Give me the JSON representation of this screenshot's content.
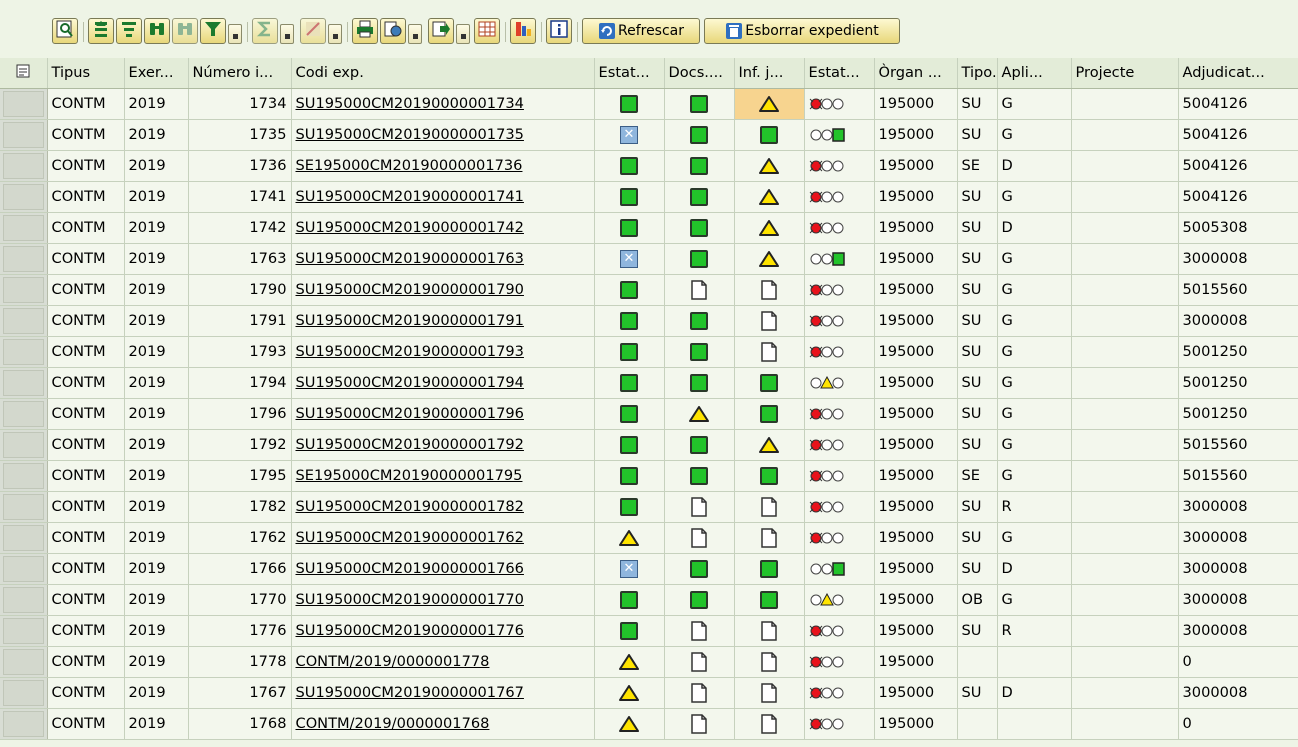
{
  "toolbar": {
    "refresh_label": "Refrescar",
    "delete_label": "Esborrar expedient"
  },
  "columns": [
    "Tipus",
    "Exer...",
    "Número i...",
    "Codi exp.",
    "Estat...",
    "Docs....",
    "Inf. j...",
    "Estat...",
    "Òrgan ...",
    "Tipo...",
    "Apli...",
    "Projecte",
    "Adjudicat..."
  ],
  "rows": [
    {
      "tipus": "CONTM",
      "exer": "2019",
      "num": "1734",
      "codi": "SU195000CM20190000001734",
      "estat": "green",
      "docs": "green",
      "inf": "warn",
      "light": "red",
      "organ": "195000",
      "tipo": "SU",
      "apli": "G",
      "projecte": "",
      "adj": "5004126",
      "inf_hl": true
    },
    {
      "tipus": "CONTM",
      "exer": "2019",
      "num": "1735",
      "codi": "SU195000CM20190000001735",
      "estat": "x",
      "docs": "green",
      "inf": "green",
      "light": "green",
      "organ": "195000",
      "tipo": "SU",
      "apli": "G",
      "projecte": "",
      "adj": "5004126"
    },
    {
      "tipus": "CONTM",
      "exer": "2019",
      "num": "1736",
      "codi": "SE195000CM20190000001736",
      "estat": "green",
      "docs": "green",
      "inf": "warn",
      "light": "red",
      "organ": "195000",
      "tipo": "SE",
      "apli": "D",
      "projecte": "",
      "adj": "5004126"
    },
    {
      "tipus": "CONTM",
      "exer": "2019",
      "num": "1741",
      "codi": "SU195000CM20190000001741",
      "estat": "green",
      "docs": "green",
      "inf": "warn",
      "light": "red",
      "organ": "195000",
      "tipo": "SU",
      "apli": "G",
      "projecte": "",
      "adj": "5004126"
    },
    {
      "tipus": "CONTM",
      "exer": "2019",
      "num": "1742",
      "codi": "SU195000CM20190000001742",
      "estat": "green",
      "docs": "green",
      "inf": "warn",
      "light": "red",
      "organ": "195000",
      "tipo": "SU",
      "apli": "D",
      "projecte": "",
      "adj": "5005308"
    },
    {
      "tipus": "CONTM",
      "exer": "2019",
      "num": "1763",
      "codi": "SU195000CM20190000001763",
      "estat": "x",
      "docs": "green",
      "inf": "warn",
      "light": "green",
      "organ": "195000",
      "tipo": "SU",
      "apli": "G",
      "projecte": "",
      "adj": "3000008"
    },
    {
      "tipus": "CONTM",
      "exer": "2019",
      "num": "1790",
      "codi": "SU195000CM20190000001790",
      "estat": "green",
      "docs": "doc",
      "inf": "doc",
      "light": "red",
      "organ": "195000",
      "tipo": "SU",
      "apli": "G",
      "projecte": "",
      "adj": "5015560"
    },
    {
      "tipus": "CONTM",
      "exer": "2019",
      "num": "1791",
      "codi": "SU195000CM20190000001791",
      "estat": "green",
      "docs": "green",
      "inf": "doc",
      "light": "red",
      "organ": "195000",
      "tipo": "SU",
      "apli": "G",
      "projecte": "",
      "adj": "3000008"
    },
    {
      "tipus": "CONTM",
      "exer": "2019",
      "num": "1793",
      "codi": "SU195000CM20190000001793",
      "estat": "green",
      "docs": "green",
      "inf": "doc",
      "light": "red",
      "organ": "195000",
      "tipo": "SU",
      "apli": "G",
      "projecte": "",
      "adj": "5001250"
    },
    {
      "tipus": "CONTM",
      "exer": "2019",
      "num": "1794",
      "codi": "SU195000CM20190000001794",
      "estat": "green",
      "docs": "green",
      "inf": "green",
      "light": "yellow",
      "organ": "195000",
      "tipo": "SU",
      "apli": "G",
      "projecte": "",
      "adj": "5001250"
    },
    {
      "tipus": "CONTM",
      "exer": "2019",
      "num": "1796",
      "codi": "SU195000CM20190000001796",
      "estat": "green",
      "docs": "warn",
      "inf": "green",
      "light": "red",
      "organ": "195000",
      "tipo": "SU",
      "apli": "G",
      "projecte": "",
      "adj": "5001250"
    },
    {
      "tipus": "CONTM",
      "exer": "2019",
      "num": "1792",
      "codi": "SU195000CM20190000001792",
      "estat": "green",
      "docs": "green",
      "inf": "warn",
      "light": "red",
      "organ": "195000",
      "tipo": "SU",
      "apli": "G",
      "projecte": "",
      "adj": "5015560"
    },
    {
      "tipus": "CONTM",
      "exer": "2019",
      "num": "1795",
      "codi": "SE195000CM20190000001795",
      "estat": "green",
      "docs": "green",
      "inf": "green",
      "light": "red",
      "organ": "195000",
      "tipo": "SE",
      "apli": "G",
      "projecte": "",
      "adj": "5015560"
    },
    {
      "tipus": "CONTM",
      "exer": "2019",
      "num": "1782",
      "codi": "SU195000CM20190000001782",
      "estat": "green",
      "docs": "doc",
      "inf": "doc",
      "light": "red",
      "organ": "195000",
      "tipo": "SU",
      "apli": "R",
      "projecte": "",
      "adj": "3000008"
    },
    {
      "tipus": "CONTM",
      "exer": "2019",
      "num": "1762",
      "codi": "SU195000CM20190000001762",
      "estat": "warn",
      "docs": "doc",
      "inf": "doc",
      "light": "red",
      "organ": "195000",
      "tipo": "SU",
      "apli": "G",
      "projecte": "",
      "adj": "3000008"
    },
    {
      "tipus": "CONTM",
      "exer": "2019",
      "num": "1766",
      "codi": "SU195000CM20190000001766",
      "estat": "x",
      "docs": "green",
      "inf": "green",
      "light": "green",
      "organ": "195000",
      "tipo": "SU",
      "apli": "D",
      "projecte": "",
      "adj": "3000008"
    },
    {
      "tipus": "CONTM",
      "exer": "2019",
      "num": "1770",
      "codi": "SU195000CM20190000001770",
      "estat": "green",
      "docs": "green",
      "inf": "green",
      "light": "yellow",
      "organ": "195000",
      "tipo": "OB",
      "apli": "G",
      "projecte": "",
      "adj": "3000008"
    },
    {
      "tipus": "CONTM",
      "exer": "2019",
      "num": "1776",
      "codi": "SU195000CM20190000001776",
      "estat": "green",
      "docs": "doc",
      "inf": "doc",
      "light": "red",
      "organ": "195000",
      "tipo": "SU",
      "apli": "R",
      "projecte": "",
      "adj": "3000008"
    },
    {
      "tipus": "CONTM",
      "exer": "2019",
      "num": "1778",
      "codi": "CONTM/2019/0000001778",
      "estat": "warn",
      "docs": "doc",
      "inf": "doc",
      "light": "red",
      "organ": "195000",
      "tipo": "",
      "apli": "",
      "projecte": "",
      "adj": "0"
    },
    {
      "tipus": "CONTM",
      "exer": "2019",
      "num": "1767",
      "codi": "SU195000CM20190000001767",
      "estat": "warn",
      "docs": "doc",
      "inf": "doc",
      "light": "red",
      "organ": "195000",
      "tipo": "SU",
      "apli": "D",
      "projecte": "",
      "adj": "3000008"
    },
    {
      "tipus": "CONTM",
      "exer": "2019",
      "num": "1768",
      "codi": "CONTM/2019/0000001768",
      "estat": "warn",
      "docs": "doc",
      "inf": "doc",
      "light": "red",
      "organ": "195000",
      "tipo": "",
      "apli": "",
      "projecte": "",
      "adj": "0"
    }
  ]
}
